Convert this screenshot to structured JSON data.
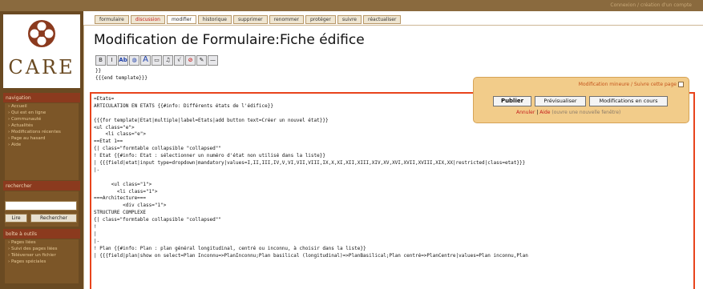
{
  "top_bar": {
    "personal_links": "Connexion / création d'un compte"
  },
  "logo": {
    "text": "CARE"
  },
  "sidebar": {
    "navigation": {
      "title": "navigation",
      "items": [
        "Accueil",
        "Qui est en ligne",
        "Communauté",
        "Actualités",
        "Modifications récentes",
        "Page au hasard",
        "Aide"
      ]
    },
    "search": {
      "title": "rechercher",
      "input_value": "",
      "go_button": "Lire",
      "search_button": "Rechercher"
    },
    "toolbox": {
      "title": "boîte à outils",
      "items": [
        "Pages liées",
        "Suivi des pages liées",
        "Téléverser un fichier",
        "Pages spéciales"
      ]
    }
  },
  "tabs": [
    {
      "label": "formulaire",
      "style": "normal"
    },
    {
      "label": "discussion",
      "style": "red"
    },
    {
      "label": "modifier",
      "style": "active"
    },
    {
      "label": "historique",
      "style": "normal"
    },
    {
      "label": "supprimer",
      "style": "normal"
    },
    {
      "label": "renommer",
      "style": "normal"
    },
    {
      "label": "protéger",
      "style": "normal"
    },
    {
      "label": "suivre",
      "style": "normal"
    },
    {
      "label": "réactualiser",
      "style": "normal"
    }
  ],
  "page": {
    "title": "Modification de Formulaire:Fiche édifice"
  },
  "toolbar_icons": [
    {
      "name": "bold-icon",
      "glyph": "B",
      "cls": "tb"
    },
    {
      "name": "italic-icon",
      "glyph": "I",
      "cls": "tb"
    },
    {
      "name": "internal-link-icon",
      "glyph": "Ab",
      "cls": "tb blue"
    },
    {
      "name": "external-link-icon",
      "glyph": "◍",
      "cls": "tb blue"
    },
    {
      "name": "headline-icon",
      "glyph": "A",
      "cls": "tb a"
    },
    {
      "name": "embedded-file-icon",
      "glyph": "▭",
      "cls": "tb"
    },
    {
      "name": "media-link-icon",
      "glyph": "♫",
      "cls": "tb"
    },
    {
      "name": "math-formula-icon",
      "glyph": "√",
      "cls": "tb"
    },
    {
      "name": "nowiki-icon",
      "glyph": "⊘",
      "cls": "tb red"
    },
    {
      "name": "signature-icon",
      "glyph": "✎",
      "cls": "tb"
    },
    {
      "name": "horizontal-line-icon",
      "glyph": "—",
      "cls": "tb"
    }
  ],
  "pre_text": "}}\n{{{end template}}}",
  "editor": {
    "lines": [
      "=Etats=",
      "ARTICULATION EN ETATS {{#info: Différents états de l'édifice}}",
      "",
      "{{{for template|Etat|multiple|label=Etats|add button text=Créer un nouvel état}}}",
      "<ul class=\"e\">",
      "    <li class=\"e\">",
      "==Etat 1==",
      "{| class=\"formtable collapsible \"collapsed\"\"",
      "! Etat {{#info: Etat : sélectionner un numéro d'état non utilisé dans la liste}}",
      "| {{{field|etat|input type=dropdown|mandatory|values=I,II,III,IV,V,VI,VII,VIII,IX,X,XI,XII,XIII,XIV,XV,XVI,XVII,XVIII,XIX,XX|restricted|class=etat}}}",
      "|-",
      "",
      "      <ul class=\"1\">",
      "        <li class=\"1\">",
      "===Architecture===",
      "          <div class=\"1\">",
      "STRUCTURE COMPLEXE",
      "{| class=\"formtable collapsible \"collapsed\"\"",
      "!",
      "|",
      "|-",
      "! Plan {{#info: Plan : plan général longitudinal, centré ou inconnu, à choisir dans la liste}}",
      "| {{{field|plan|show on select=Plan Inconnu=>PlanInconnu;Plan basilical (longitudinal)=>PlanBasilical;Plan centré=>PlanCentre|values=Plan inconnu,Plan"
    ]
  },
  "save_panel": {
    "watch_label": "Modification mineure / Suivre cette page",
    "publish_button": "Publier",
    "preview_button": "Prévisualiser",
    "changes_button": "Modifications en cours",
    "cancel_link": "Annuler",
    "help_link": "Aide",
    "new_window_text": "(ouvre une nouvelle fenêtre)"
  }
}
